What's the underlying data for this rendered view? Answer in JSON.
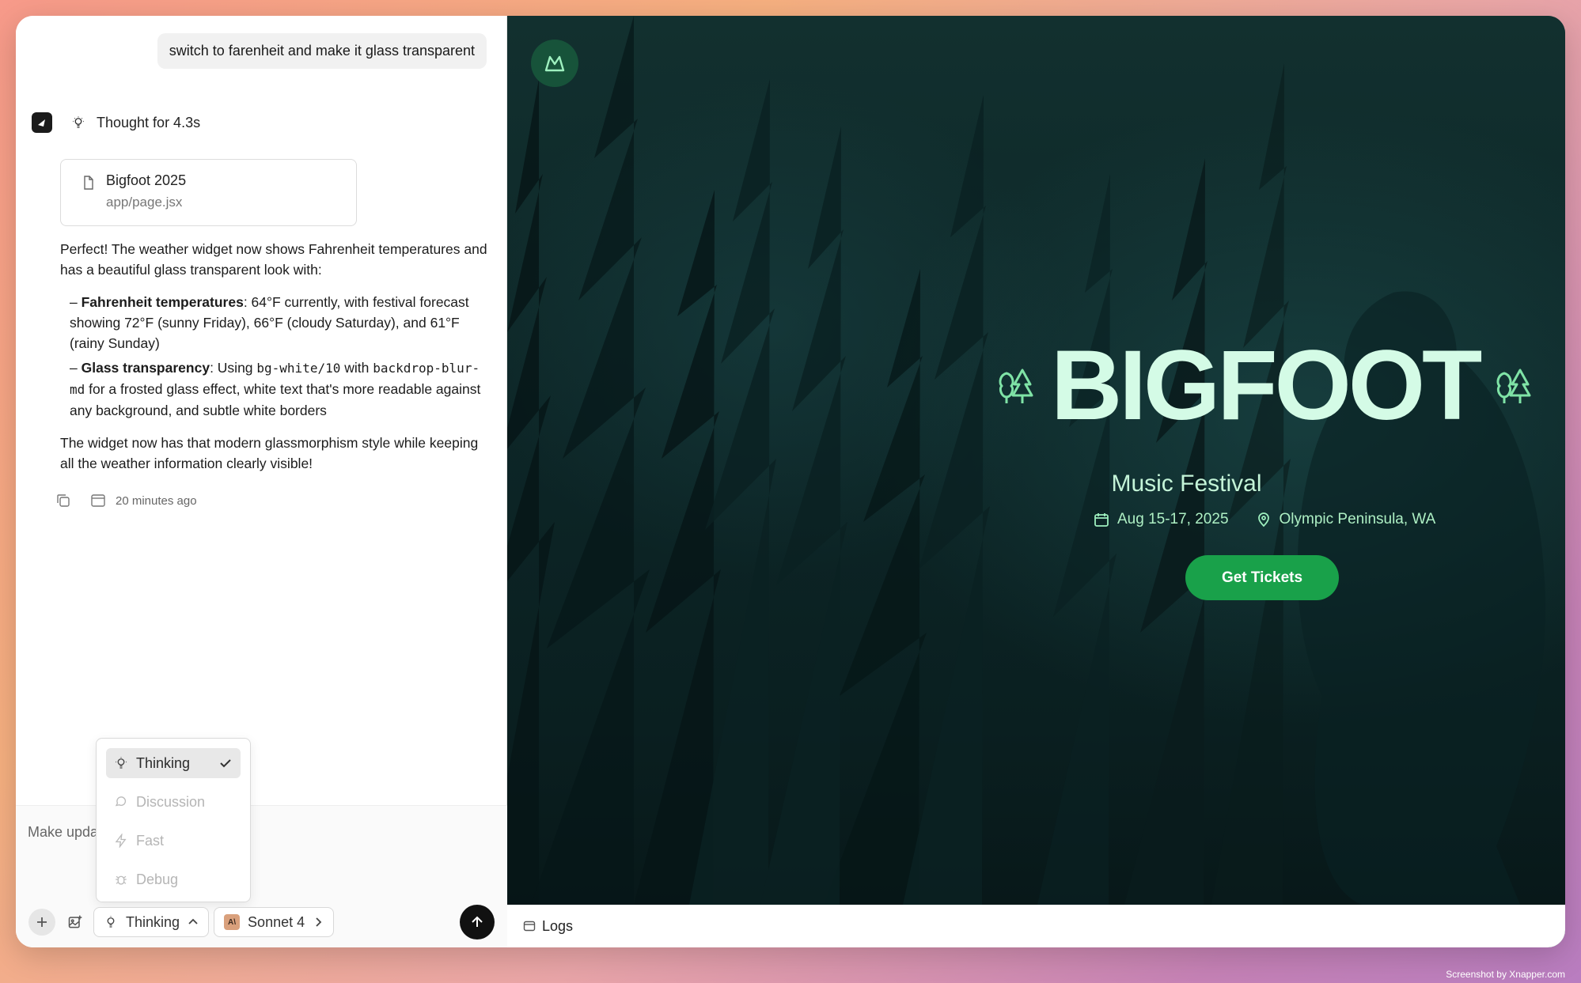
{
  "chat": {
    "user_message": "switch to farenheit and make it glass transparent",
    "thought_label": "Thought for 4.3s",
    "file_card": {
      "title": "Bigfoot 2025",
      "path": "app/page.jsx"
    },
    "intro": "Perfect! The weather widget now shows Fahrenheit temperatures and has a beautiful glass transparent look with:",
    "bullet1_bold": "Fahrenheit temperatures",
    "bullet1_text": ": 64°F currently, with festival forecast showing 72°F (sunny Friday), 66°F (cloudy Saturday), and 61°F (rainy Sunday)",
    "bullet2_bold": "Glass transparency",
    "bullet2_a": ": Using ",
    "bullet2_code1": "bg-white/10",
    "bullet2_b": " with ",
    "bullet2_code2": "backdrop-blur-md",
    "bullet2_c": " for a frosted glass effect, white text that's more readable against any background, and subtle white borders",
    "outro": "The widget now has that modern glassmorphism style while keeping all the weather information clearly visible!",
    "timestamp": "20 minutes ago"
  },
  "composer": {
    "placeholder": "Make upda",
    "mode_label": "Thinking",
    "model_label": "Sonnet 4"
  },
  "mode_menu": {
    "items": [
      {
        "label": "Thinking",
        "icon": "lightbulb-icon"
      },
      {
        "label": "Discussion",
        "icon": "chat-icon"
      },
      {
        "label": "Fast",
        "icon": "lightning-icon"
      },
      {
        "label": "Debug",
        "icon": "bug-icon"
      }
    ],
    "selected": "Thinking"
  },
  "preview": {
    "title": "BIGFOOT",
    "subtitle": "Music Festival",
    "date": "Aug 15-17, 2025",
    "location": "Olympic Peninsula, WA",
    "cta": "Get Tickets",
    "logs_label": "Logs"
  },
  "watermark": "Screenshot by Xnapper.com",
  "colors": {
    "accent_green": "#19a14a",
    "title_mint": "#d4fbe6",
    "info_green": "#aef0c4"
  }
}
